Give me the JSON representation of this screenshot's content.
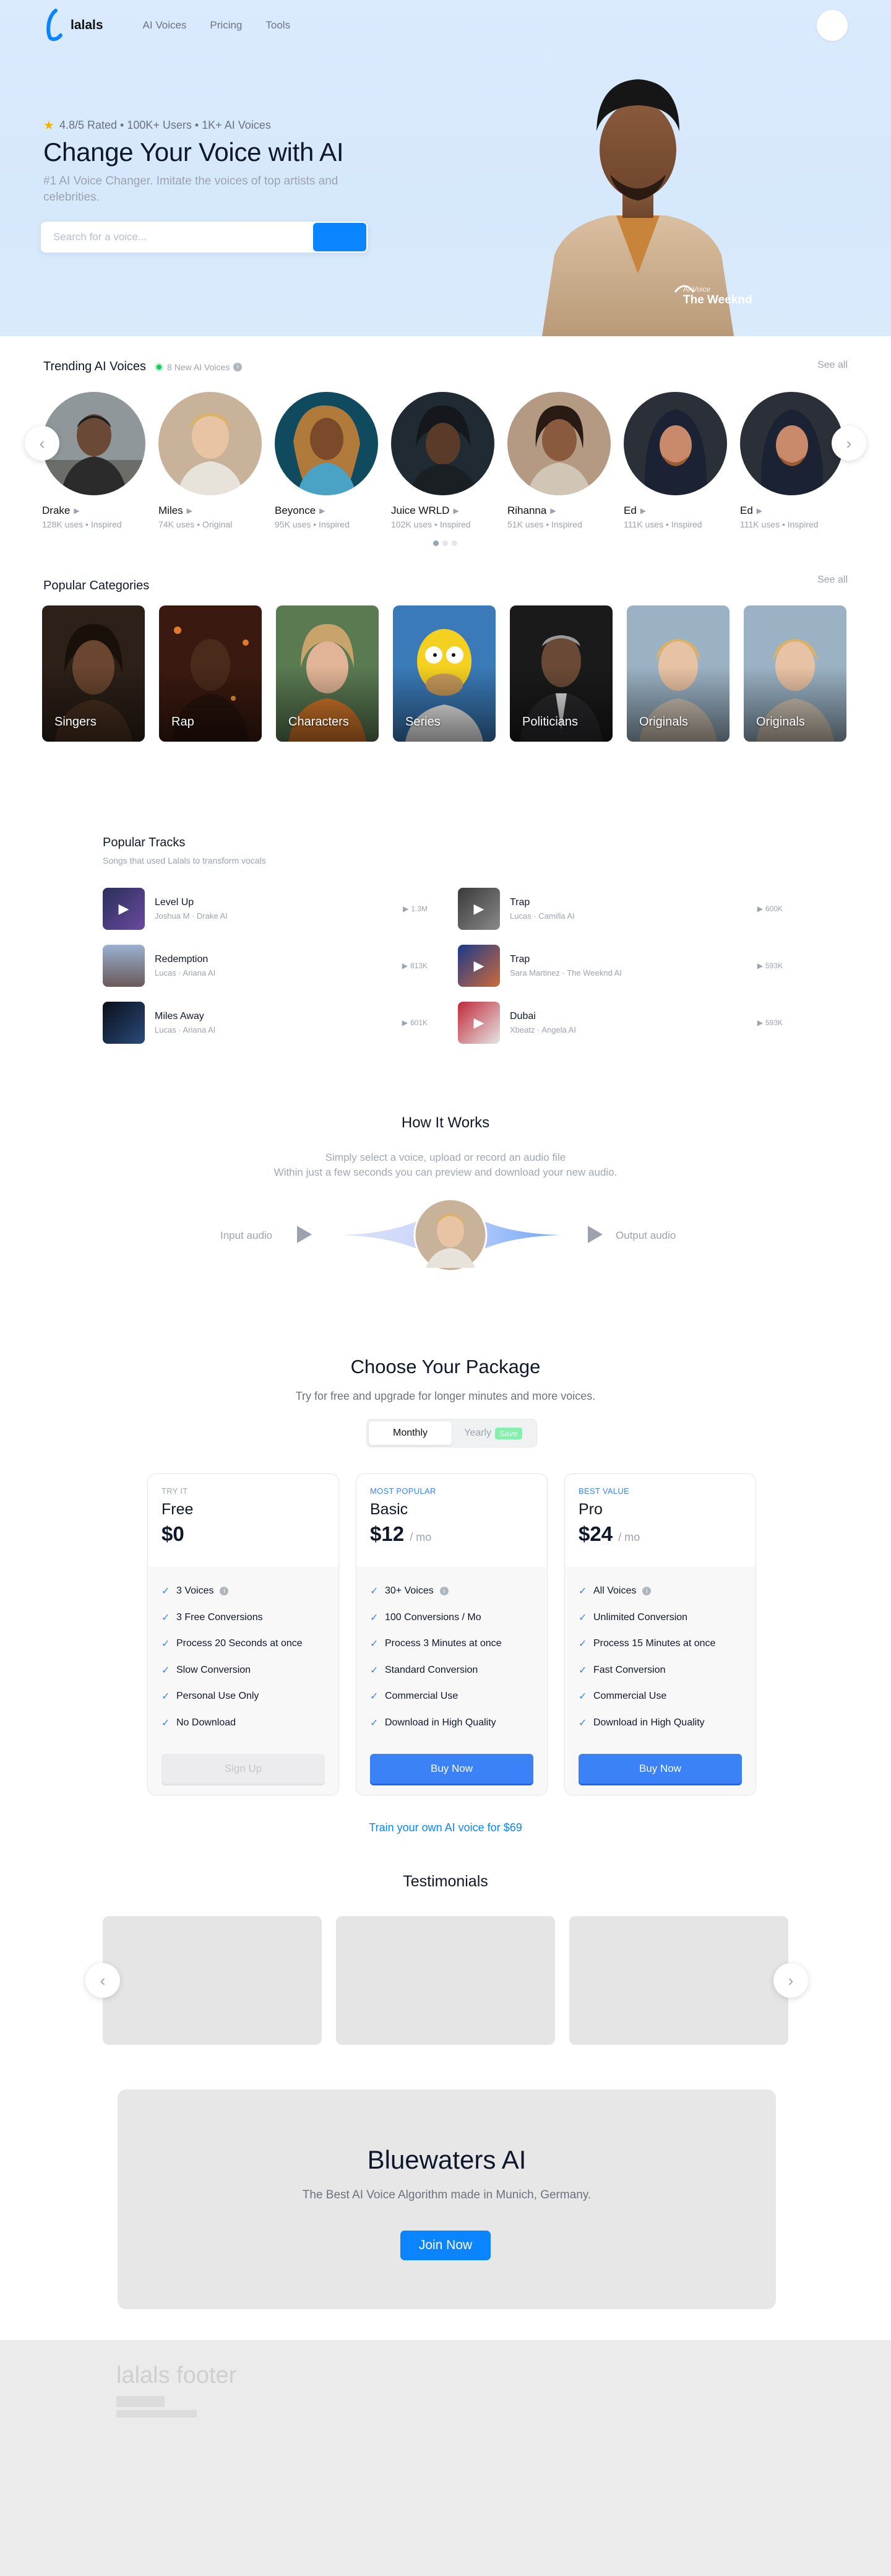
{
  "nav": {
    "brand": "lalals",
    "links": [
      "AI Voices",
      "Pricing",
      "Tools"
    ]
  },
  "hero": {
    "rating": "4.8/5 Rated • 100K+ Users • 1K+ AI Voices",
    "title": "Change Your Voice with AI",
    "subtitle": "#1 AI Voice Changer. Imitate the voices of top artists and celebrities.",
    "search_placeholder": "Search for a voice...",
    "tag_small": "AI Voice",
    "tag_name": "The Weeknd"
  },
  "trending": {
    "title": "Trending AI Voices",
    "badge": "8 New AI Voices",
    "see_all": "See all",
    "voices": [
      {
        "name": "Drake",
        "meta": "128K uses • Inspired"
      },
      {
        "name": "Miles",
        "meta": "74K uses • Original"
      },
      {
        "name": "Beyonce",
        "meta": "95K uses • Inspired"
      },
      {
        "name": "Juice WRLD",
        "meta": "102K uses • Inspired"
      },
      {
        "name": "Rihanna",
        "meta": "51K uses • Inspired"
      },
      {
        "name": "Ed",
        "meta": "111K uses • Inspired"
      },
      {
        "name": "Ed",
        "meta": "111K uses • Inspired"
      }
    ]
  },
  "categories": {
    "title": "Popular Categories",
    "see_all": "See all",
    "items": [
      "Singers",
      "Rap",
      "Characters",
      "Series",
      "Politicians",
      "Originals",
      "Originals"
    ]
  },
  "tracks": {
    "title": "Popular Tracks",
    "subtitle": "Songs that used Lalals to transform vocals",
    "items": [
      {
        "title": "Level Up",
        "artist": "Joshua M · Drake AI",
        "plays": "1.3M"
      },
      {
        "title": "Trap",
        "artist": "Lucas · Camilla AI",
        "plays": "600K"
      },
      {
        "title": "Redemption",
        "artist": "Lucas · Ariana AI",
        "plays": "813K"
      },
      {
        "title": "Trap",
        "artist": "Sara Martinez · The Weeknd AI",
        "plays": "593K"
      },
      {
        "title": "Miles Away",
        "artist": "Lucas · Ariana AI",
        "plays": "601K"
      },
      {
        "title": "Dubai",
        "artist": "Xbeatz · Angela AI",
        "plays": "593K"
      }
    ]
  },
  "how": {
    "title": "How It Works",
    "line1": "Simply select a voice, upload or record an audio file",
    "line2": "Within just a few seconds you can preview and download your new audio.",
    "input_label": "Input audio",
    "output_label": "Output audio"
  },
  "pricing": {
    "title": "Choose Your Package",
    "subtitle": "Try for free and upgrade for longer minutes and more voices.",
    "toggle_monthly": "Monthly",
    "toggle_yearly": "Yearly",
    "save_label": "Save",
    "plans": [
      {
        "kicker": "TRY IT",
        "name": "Free",
        "price": "$0",
        "per": "",
        "features": [
          "3 Voices",
          "3 Free Conversions",
          "Process 20 Seconds at once",
          "Slow Conversion",
          "Personal Use Only",
          "No Download"
        ],
        "button": "Sign Up"
      },
      {
        "kicker": "MOST POPULAR",
        "name": "Basic",
        "price": "$12",
        "per": "/ mo",
        "features": [
          "30+ Voices",
          "100 Conversions / Mo",
          "Process 3 Minutes at once",
          "Standard Conversion",
          "Commercial Use",
          "Download in High Quality"
        ],
        "button": "Buy Now"
      },
      {
        "kicker": "BEST VALUE",
        "name": "Pro",
        "price": "$24",
        "per": "/ mo",
        "features": [
          "All Voices",
          "Unlimited Conversion",
          "Process 15 Minutes at once",
          "Fast Conversion",
          "Commercial Use",
          "Download in High Quality"
        ],
        "button": "Buy Now"
      }
    ],
    "train_link": "Train your own AI voice for $69"
  },
  "testimonials": {
    "title": "Testimonials"
  },
  "cta": {
    "title": "Bluewaters AI",
    "subtitle": "The Best AI Voice Algorithm made in Munich, Germany.",
    "button": "Join Now"
  },
  "footer": {
    "title": "lalals footer"
  },
  "colors": {
    "accent": "#0a84ff",
    "plan_button": "#3b82f6",
    "hero_bg": "#dbeafe"
  }
}
